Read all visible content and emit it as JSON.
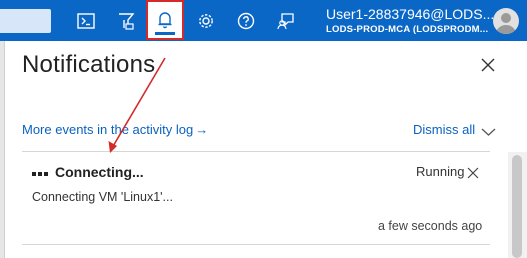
{
  "topbar": {
    "icons": [
      "cloud-shell-icon",
      "directory-filter-icon",
      "notifications-bell-icon",
      "settings-gear-icon",
      "help-icon",
      "feedback-icon"
    ],
    "account": {
      "user": "User1-28837946@LODS...",
      "directory": "LODS-PROD-MCA (LODSPRODM..."
    },
    "colors": {
      "bar": "#0a67c6",
      "highlight": "#d42a2a"
    }
  },
  "panel": {
    "title": "Notifications",
    "activity_link": "More events in the activity log",
    "activity_arrow": "→",
    "dismiss_all": "Dismiss all"
  },
  "notification": {
    "title": "Connecting...",
    "status": "Running",
    "description": "Connecting VM 'Linux1'...",
    "time": "a few seconds ago"
  }
}
